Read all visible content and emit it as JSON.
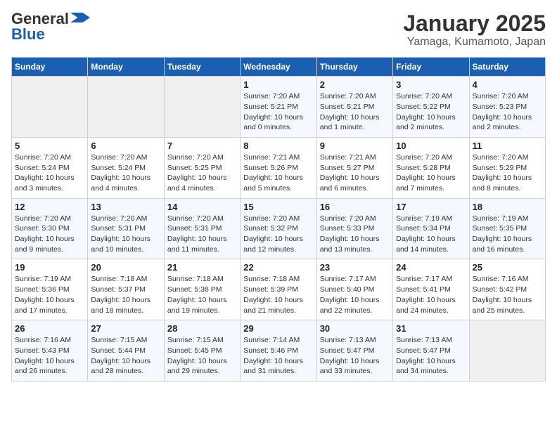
{
  "header": {
    "logo_line1": "General",
    "logo_line2": "Blue",
    "title": "January 2025",
    "subtitle": "Yamaga, Kumamoto, Japan"
  },
  "days_of_week": [
    "Sunday",
    "Monday",
    "Tuesday",
    "Wednesday",
    "Thursday",
    "Friday",
    "Saturday"
  ],
  "weeks": [
    [
      {
        "day": "",
        "info": ""
      },
      {
        "day": "",
        "info": ""
      },
      {
        "day": "",
        "info": ""
      },
      {
        "day": "1",
        "info": "Sunrise: 7:20 AM\nSunset: 5:21 PM\nDaylight: 10 hours and 0 minutes."
      },
      {
        "day": "2",
        "info": "Sunrise: 7:20 AM\nSunset: 5:21 PM\nDaylight: 10 hours and 1 minute."
      },
      {
        "day": "3",
        "info": "Sunrise: 7:20 AM\nSunset: 5:22 PM\nDaylight: 10 hours and 2 minutes."
      },
      {
        "day": "4",
        "info": "Sunrise: 7:20 AM\nSunset: 5:23 PM\nDaylight: 10 hours and 2 minutes."
      }
    ],
    [
      {
        "day": "5",
        "info": "Sunrise: 7:20 AM\nSunset: 5:24 PM\nDaylight: 10 hours and 3 minutes."
      },
      {
        "day": "6",
        "info": "Sunrise: 7:20 AM\nSunset: 5:24 PM\nDaylight: 10 hours and 4 minutes."
      },
      {
        "day": "7",
        "info": "Sunrise: 7:20 AM\nSunset: 5:25 PM\nDaylight: 10 hours and 4 minutes."
      },
      {
        "day": "8",
        "info": "Sunrise: 7:21 AM\nSunset: 5:26 PM\nDaylight: 10 hours and 5 minutes."
      },
      {
        "day": "9",
        "info": "Sunrise: 7:21 AM\nSunset: 5:27 PM\nDaylight: 10 hours and 6 minutes."
      },
      {
        "day": "10",
        "info": "Sunrise: 7:20 AM\nSunset: 5:28 PM\nDaylight: 10 hours and 7 minutes."
      },
      {
        "day": "11",
        "info": "Sunrise: 7:20 AM\nSunset: 5:29 PM\nDaylight: 10 hours and 8 minutes."
      }
    ],
    [
      {
        "day": "12",
        "info": "Sunrise: 7:20 AM\nSunset: 5:30 PM\nDaylight: 10 hours and 9 minutes."
      },
      {
        "day": "13",
        "info": "Sunrise: 7:20 AM\nSunset: 5:31 PM\nDaylight: 10 hours and 10 minutes."
      },
      {
        "day": "14",
        "info": "Sunrise: 7:20 AM\nSunset: 5:31 PM\nDaylight: 10 hours and 11 minutes."
      },
      {
        "day": "15",
        "info": "Sunrise: 7:20 AM\nSunset: 5:32 PM\nDaylight: 10 hours and 12 minutes."
      },
      {
        "day": "16",
        "info": "Sunrise: 7:20 AM\nSunset: 5:33 PM\nDaylight: 10 hours and 13 minutes."
      },
      {
        "day": "17",
        "info": "Sunrise: 7:19 AM\nSunset: 5:34 PM\nDaylight: 10 hours and 14 minutes."
      },
      {
        "day": "18",
        "info": "Sunrise: 7:19 AM\nSunset: 5:35 PM\nDaylight: 10 hours and 16 minutes."
      }
    ],
    [
      {
        "day": "19",
        "info": "Sunrise: 7:19 AM\nSunset: 5:36 PM\nDaylight: 10 hours and 17 minutes."
      },
      {
        "day": "20",
        "info": "Sunrise: 7:18 AM\nSunset: 5:37 PM\nDaylight: 10 hours and 18 minutes."
      },
      {
        "day": "21",
        "info": "Sunrise: 7:18 AM\nSunset: 5:38 PM\nDaylight: 10 hours and 19 minutes."
      },
      {
        "day": "22",
        "info": "Sunrise: 7:18 AM\nSunset: 5:39 PM\nDaylight: 10 hours and 21 minutes."
      },
      {
        "day": "23",
        "info": "Sunrise: 7:17 AM\nSunset: 5:40 PM\nDaylight: 10 hours and 22 minutes."
      },
      {
        "day": "24",
        "info": "Sunrise: 7:17 AM\nSunset: 5:41 PM\nDaylight: 10 hours and 24 minutes."
      },
      {
        "day": "25",
        "info": "Sunrise: 7:16 AM\nSunset: 5:42 PM\nDaylight: 10 hours and 25 minutes."
      }
    ],
    [
      {
        "day": "26",
        "info": "Sunrise: 7:16 AM\nSunset: 5:43 PM\nDaylight: 10 hours and 26 minutes."
      },
      {
        "day": "27",
        "info": "Sunrise: 7:15 AM\nSunset: 5:44 PM\nDaylight: 10 hours and 28 minutes."
      },
      {
        "day": "28",
        "info": "Sunrise: 7:15 AM\nSunset: 5:45 PM\nDaylight: 10 hours and 29 minutes."
      },
      {
        "day": "29",
        "info": "Sunrise: 7:14 AM\nSunset: 5:46 PM\nDaylight: 10 hours and 31 minutes."
      },
      {
        "day": "30",
        "info": "Sunrise: 7:13 AM\nSunset: 5:47 PM\nDaylight: 10 hours and 33 minutes."
      },
      {
        "day": "31",
        "info": "Sunrise: 7:13 AM\nSunset: 5:47 PM\nDaylight: 10 hours and 34 minutes."
      },
      {
        "day": "",
        "info": ""
      }
    ]
  ]
}
